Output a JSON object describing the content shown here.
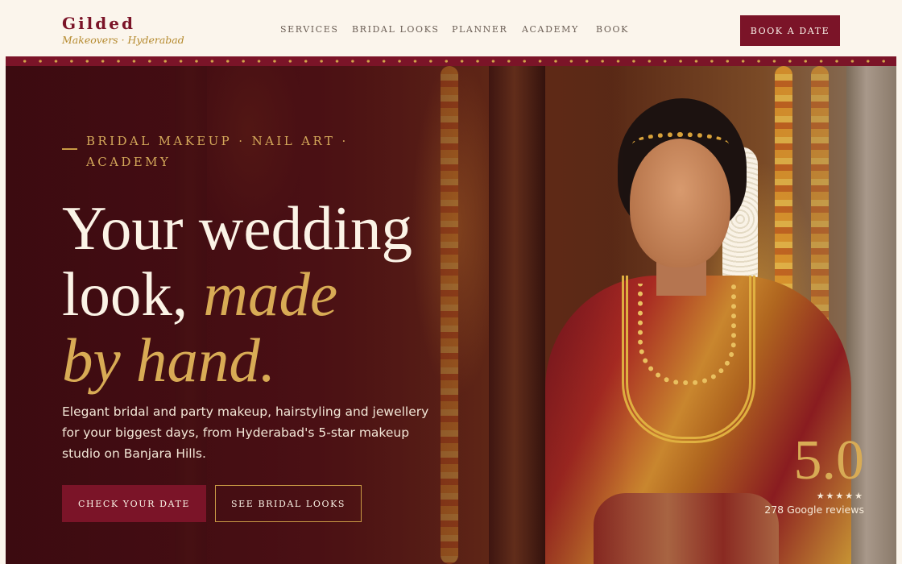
{
  "brand": {
    "name": "Gilded",
    "tagline": "Makeovers · Hyderabad"
  },
  "nav": {
    "items": [
      {
        "label": "SERVICES"
      },
      {
        "label": "BRIDAL LOOKS"
      },
      {
        "label": "PLANNER"
      },
      {
        "label": "ACADEMY"
      },
      {
        "label": "BOOK"
      }
    ],
    "cta_label": "BOOK A DATE"
  },
  "hero": {
    "eyebrow": "BRIDAL MAKEUP · NAIL ART · ACADEMY",
    "headline": {
      "line1": "Your wedding",
      "line2_plain": "look, ",
      "line2_accent": "made",
      "line3_accent": "by hand."
    },
    "subtitle": "Elegant bridal and party makeup, hairstyling and jewellery for your biggest days, from Hyderabad's 5-star makeup studio on Banjara Hills.",
    "primary_cta": "CHECK YOUR DATE",
    "secondary_cta": "SEE BRIDAL LOOKS",
    "image_description_icon": "bride-photo"
  },
  "rating": {
    "score": "5.0",
    "stars": "★★★★★",
    "stars_value": 5,
    "count_label": "278 Google reviews"
  },
  "colors": {
    "maroon": "#7b1428",
    "gold": "#d8ab55",
    "cream": "#fbf5ec"
  }
}
